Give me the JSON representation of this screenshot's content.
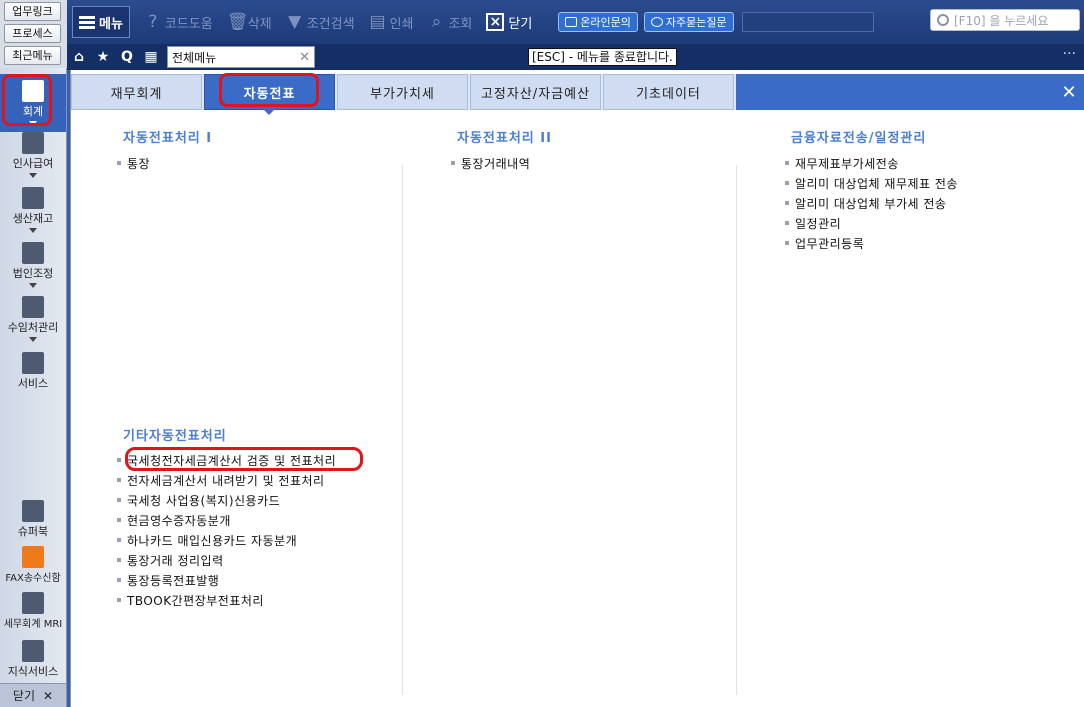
{
  "quicklinks": [
    "업무링크",
    "프로세스",
    "최근메뉴"
  ],
  "toolbar": {
    "menu_label": "메뉴",
    "buttons": [
      {
        "label": "코드도움",
        "icon": "question-icon"
      },
      {
        "label": "삭제",
        "icon": "trash-icon"
      },
      {
        "label": "조건검색",
        "icon": "filter-icon"
      },
      {
        "label": "인쇄",
        "icon": "printer-icon"
      },
      {
        "label": "조회",
        "icon": "search-doc-icon"
      }
    ],
    "close_label": "닫기",
    "online_inquiry": "온라인문의",
    "faq": "자주묻는질문",
    "search_placeholder": "[F10] 을 누르세요"
  },
  "tabrow": {
    "doc_tab": "전체메뉴",
    "esc_message": "[ESC] - 메뉴를 종료합니다."
  },
  "sidebar": {
    "items": [
      {
        "label": "회계",
        "icon": "calculator-icon"
      },
      {
        "label": "인사급여",
        "icon": "person-coin-icon"
      },
      {
        "label": "생산재고",
        "icon": "grid-icon"
      },
      {
        "label": "법인조정",
        "icon": "building-icon"
      },
      {
        "label": "수임처관리",
        "icon": "people-icon"
      },
      {
        "label": "서비스",
        "icon": "monitor-icon"
      },
      {
        "label": "슈퍼북",
        "icon": "sb-book-icon"
      },
      {
        "label": "FAX송수신함",
        "icon": "fax-icon"
      },
      {
        "label": "세무회계 MRI",
        "icon": "chart-pulse-icon"
      },
      {
        "label": "지식서비스",
        "icon": "open-book-icon"
      }
    ],
    "close_label": "닫기"
  },
  "categories": [
    "재무회계",
    "자동전표",
    "부가가치세",
    "고정자산/자금예산",
    "기초데이터"
  ],
  "sections": {
    "s1": {
      "title": "자동전표처리 I",
      "items": [
        "통장"
      ]
    },
    "s2": {
      "title": "자동전표처리 II",
      "items": [
        "통장거래내역"
      ]
    },
    "s3": {
      "title": "금융자료전송/일정관리",
      "items": [
        "재무제표부가세전송",
        "알리미 대상업체 재무제표 전송",
        "알리미 대상업체 부가세 전송",
        "일정관리",
        "업무관리등록"
      ]
    },
    "s4": {
      "title": "기타자동전표처리",
      "items": [
        "국세청전자세금계산서 검증 및 전표처리",
        "전자세금계산서 내려받기 및 전표처리",
        "국세청 사업용(복지)신용카드",
        "현금영수증자동분개",
        "하나카드 매입신용카드 자동분개",
        "통장거래 정리입력",
        "통장등록전표발행",
        "TBOOK간편장부전표처리"
      ]
    }
  },
  "colors": {
    "accent": "#3a6bc6",
    "highlight": "#e0141c",
    "section_title": "#4b7fd1"
  }
}
